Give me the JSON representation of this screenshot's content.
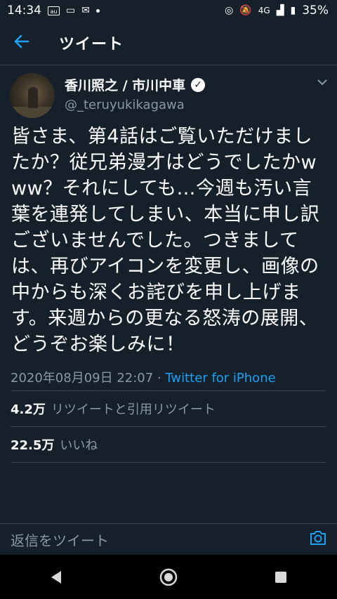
{
  "status": {
    "time": "14:34",
    "network": "4G",
    "battery": "35%"
  },
  "appbar": {
    "title": "ツイート"
  },
  "tweet": {
    "author_name": "香川照之 / 市川中車",
    "handle": "@_teruyukikagawa",
    "text": "皆さま、第4話はご覧いただけましたか？従兄弟漫才はどうでしたかwww？それにしても…今週も汚い言葉を連発してしまい、本当に申し訳ございませんでした。つきましては、再びアイコンを変更し、画像の中からも深くお詫びを申し上げます。来週からの更なる怒涛の展開、どうぞお楽しみに！",
    "timestamp": "2020年08月09日 22:07",
    "separator": " · ",
    "source": "Twitter for iPhone"
  },
  "stats": {
    "retweets_count": "4.2万",
    "retweets_label": "リツイートと引用リツイート",
    "likes_count": "22.5万",
    "likes_label": "いいね"
  },
  "reply": {
    "placeholder": "返信をツイート"
  },
  "colors": {
    "background": "#15202b",
    "accent": "#1da1f2",
    "secondary_text": "#8899a6",
    "divider": "#38444d"
  }
}
